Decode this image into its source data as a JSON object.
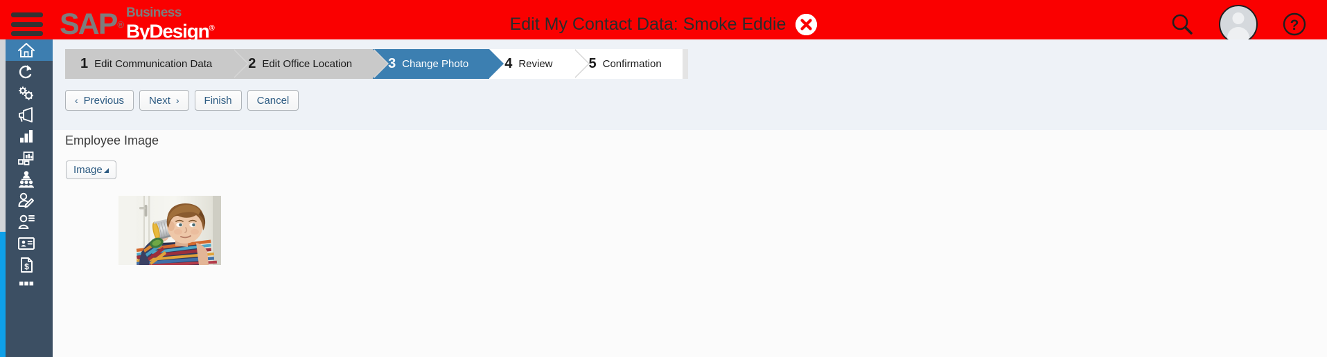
{
  "app": {
    "brand_sap": "SAP",
    "brand_reg": "®",
    "brand_business": "Business",
    "brand_bydesign": "ByDesign",
    "brand_tm": "®",
    "title": "Edit My Contact Data: Smoke Eddie",
    "header_bg": "#fa0000",
    "sidebar_bg": "#3c4f63",
    "accent_blue": "#3c7fb1",
    "scrollbar_blue": "#0fa0e8"
  },
  "header": {
    "menu_icon": "hamburger-menu-icon",
    "close_label": "close-icon",
    "search_icon": "search-icon",
    "avatar_icon": "user-avatar-icon",
    "help_icon": "help-question-icon"
  },
  "sidebar": {
    "items": [
      {
        "name": "home",
        "icon": "home-icon",
        "active": true
      },
      {
        "name": "recent",
        "icon": "recent-arrow-icon",
        "active": false
      },
      {
        "name": "settings",
        "icon": "gears-icon",
        "active": false
      },
      {
        "name": "feed",
        "icon": "megaphone-icon",
        "active": false
      },
      {
        "name": "reports",
        "icon": "bar-chart-icon",
        "active": false
      },
      {
        "name": "analytics",
        "icon": "chart-blocks-icon",
        "active": false
      },
      {
        "name": "people",
        "icon": "people-group-icon",
        "active": false
      },
      {
        "name": "edit-person",
        "icon": "person-edit-icon",
        "active": false
      },
      {
        "name": "person-list",
        "icon": "person-list-icon",
        "active": false
      },
      {
        "name": "id-card",
        "icon": "id-card-icon",
        "active": false
      },
      {
        "name": "payroll",
        "icon": "document-dollar-icon",
        "active": false
      },
      {
        "name": "more",
        "icon": "grid-icon",
        "active": false
      }
    ]
  },
  "wizard": {
    "steps": [
      {
        "num": "1",
        "label": "Edit Communication Data",
        "state": "done"
      },
      {
        "num": "2",
        "label": "Edit Office Location",
        "state": "done"
      },
      {
        "num": "3",
        "label": "Change Photo",
        "state": "active"
      },
      {
        "num": "4",
        "label": "Review",
        "state": "todo"
      },
      {
        "num": "5",
        "label": "Confirmation",
        "state": "todo"
      }
    ]
  },
  "toolbar": {
    "previous_label": "Previous",
    "previous_chevron": "‹",
    "next_label": "Next",
    "next_chevron": "›",
    "finish_label": "Finish",
    "cancel_label": "Cancel"
  },
  "main": {
    "section_title": "Employee Image",
    "image_button_label": "Image",
    "photo_alt": "Young boy holding a tin can to his ear, wearing a multicolor striped shirt, white door in background"
  }
}
